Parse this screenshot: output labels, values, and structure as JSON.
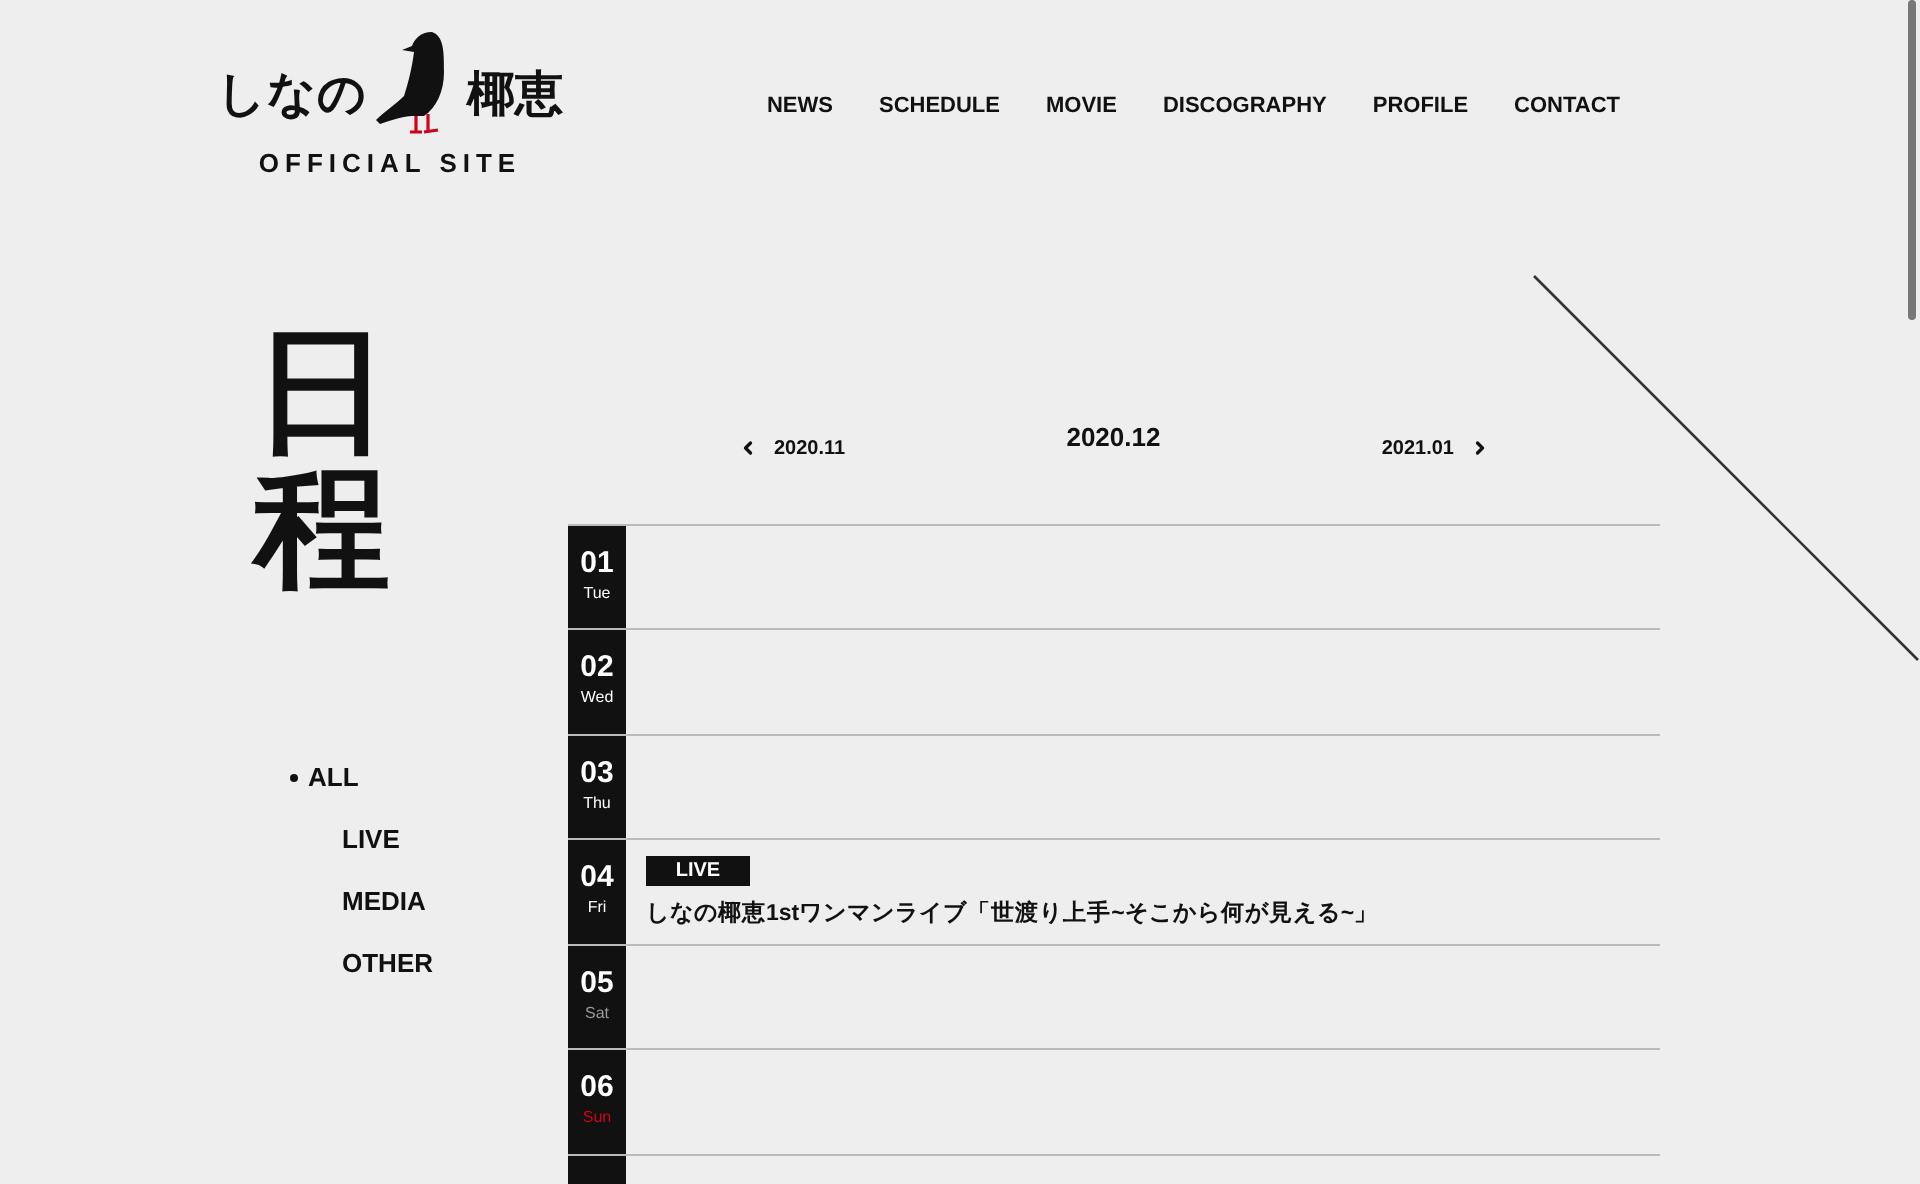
{
  "logo": {
    "name_left": "しなの",
    "name_right": "椰恵",
    "subtitle": "OFFICIAL SITE"
  },
  "nav": [
    "NEWS",
    "SCHEDULE",
    "MOVIE",
    "DISCOGRAPHY",
    "PROFILE",
    "CONTACT"
  ],
  "page_title": "日程",
  "filters": [
    {
      "label": "ALL",
      "selected": true
    },
    {
      "label": "LIVE",
      "selected": false
    },
    {
      "label": "MEDIA",
      "selected": false
    },
    {
      "label": "OTHER",
      "selected": false
    }
  ],
  "month_nav": {
    "prev": "2020.11",
    "current": "2020.12",
    "next": "2021.01"
  },
  "days": [
    {
      "date": "01",
      "weekday": "Tue",
      "color": "#ffffff"
    },
    {
      "date": "02",
      "weekday": "Wed",
      "color": "#ffffff"
    },
    {
      "date": "03",
      "weekday": "Thu",
      "color": "#ffffff"
    },
    {
      "date": "04",
      "weekday": "Fri",
      "color": "#ffffff",
      "events": [
        {
          "tag": "LIVE",
          "title": "しなの椰恵1stワンマンライブ「世渡り上手~そこから何が見える~」"
        }
      ]
    },
    {
      "date": "05",
      "weekday": "Sat",
      "color": "#9a9a9a"
    },
    {
      "date": "06",
      "weekday": "Sun",
      "color": "#d0021b"
    }
  ]
}
